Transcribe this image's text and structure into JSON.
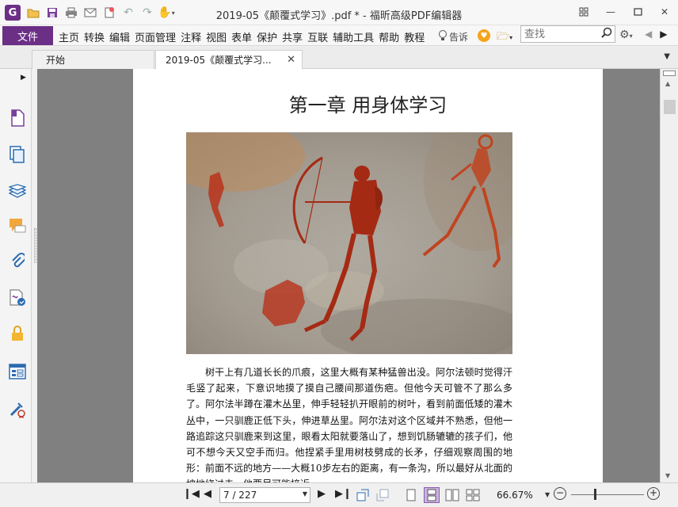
{
  "titlebar": {
    "app_logo": "G",
    "title": "2019-05《颠覆式学习》.pdf * - 福昕高级PDF编辑器",
    "quick_access": [
      "folder-open-icon",
      "save-icon",
      "print-icon",
      "email-icon",
      "new-icon",
      "undo-icon",
      "redo-icon",
      "hand-tool-icon"
    ],
    "window_buttons": [
      "restore-layout-icon",
      "minimize-icon",
      "maximize-icon",
      "close-icon"
    ]
  },
  "menubar": {
    "file_label": "文件",
    "items": [
      "主页",
      "转换",
      "编辑",
      "页面管理",
      "注释",
      "视图",
      "表单",
      "保护",
      "共享",
      "互联",
      "辅助工具",
      "帮助",
      "教程"
    ],
    "tell_me": "告诉",
    "search_placeholder": "查找"
  },
  "tabs": [
    {
      "label": "开始"
    },
    {
      "label": "2019-05《颠覆式学习..."
    }
  ],
  "sidebar": {
    "icons": [
      "page-thumbnail-icon",
      "pages-icon",
      "layers-icon",
      "comments-icon",
      "attachments-icon",
      "signature-icon",
      "security-lock-icon",
      "form-fields-icon",
      "certify-icon"
    ]
  },
  "document": {
    "chapter_title": "第一章 用身体学习",
    "paragraph": "树干上有几道长长的爪痕，这里大概有某种猛兽出没。阿尔法顿时觉得汗毛竖了起来，下意识地摸了摸自己腰间那道伤疤。但他今天可管不了那么多了。阿尔法半蹲在灌木丛里，伸手轻轻扒开眼前的树叶，看到前面低矮的灌木丛中，一只驯鹿正低下头，伸进草丛里。阿尔法对这个区域并不熟悉，但他一路追踪这只驯鹿来到这里，眼看太阳就要落山了，想到饥肠辘辘的孩子们，他可不想今天又空手而归。他捏紧手里用树枝劈成的长矛，仔细观察周围的地形：前面不远的地方——大概10步左右的距离，有一条沟，所以最好从北面的坡地绕过去，他要尽可能接近"
  },
  "statusbar": {
    "page_indicator": "7 / 227",
    "zoom_percent": "66.67%",
    "zoom_level": 0.33
  },
  "colors": {
    "brand_purple": "#6b2f86",
    "active_view": "#c9b4de",
    "canvas_gray": "#808080"
  }
}
